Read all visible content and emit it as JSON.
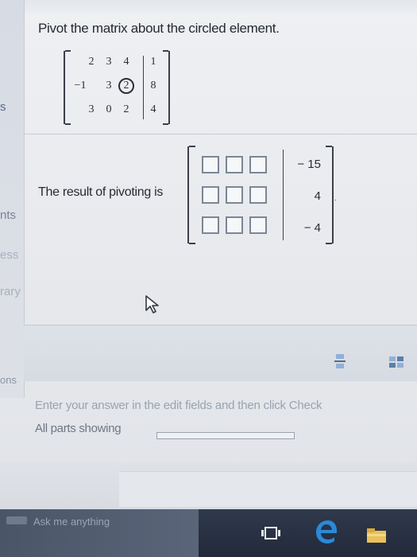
{
  "sidebar": {
    "items": [
      "s",
      "nts",
      "ess",
      "rary",
      "ons"
    ]
  },
  "question": {
    "prompt": "Pivot the matrix about the circled element."
  },
  "given_matrix": {
    "rows": [
      [
        "2",
        "3",
        "4",
        "1"
      ],
      [
        "−1",
        "3",
        "2",
        "8"
      ],
      [
        "3",
        "0",
        "2",
        "4"
      ]
    ],
    "circled": "2"
  },
  "result": {
    "label": "The result of pivoting is",
    "fields": [
      [
        "",
        "",
        ""
      ],
      [
        "",
        "",
        ""
      ],
      [
        "",
        "",
        ""
      ]
    ],
    "constants": [
      "− 15",
      "4",
      "− 4"
    ]
  },
  "toolbar": {
    "fraction_button": "fraction-icon",
    "matrix_button": "matrix-icon"
  },
  "instructions": {
    "hint": "Enter your answer in the edit fields and then click Check",
    "status": "All parts showing"
  },
  "progress": {
    "value": 0
  },
  "taskbar": {
    "search_placeholder": "Ask me anything"
  },
  "colors": {
    "taskbar": "#22293a",
    "page": "#eef0f3",
    "edge_blue": "#2a8ad8"
  }
}
